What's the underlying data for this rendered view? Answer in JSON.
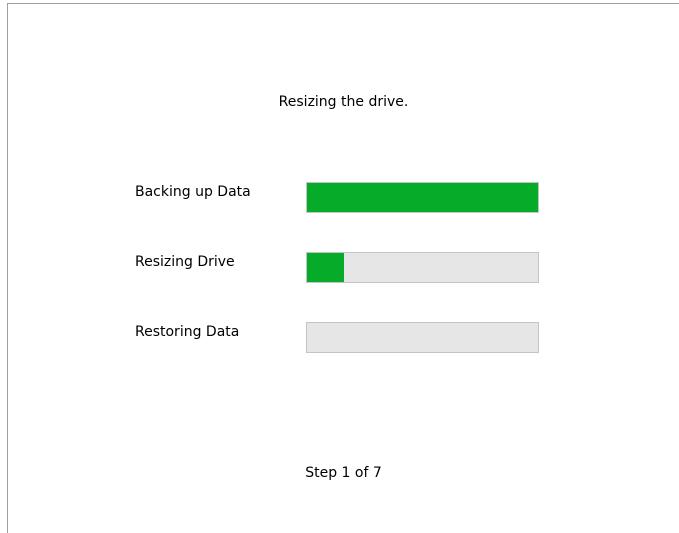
{
  "heading": "Resizing the drive.",
  "tasks": [
    {
      "label": "Backing up Data",
      "progress": 1.0
    },
    {
      "label": "Resizing Drive",
      "progress": 0.16
    },
    {
      "label": "Restoring Data",
      "progress": 0.0
    }
  ],
  "footer": "Step 1 of 7",
  "colors": {
    "progress_fill": "#06ab29",
    "progress_track": "#e6e6e6",
    "progress_border": "#c4c4c4"
  }
}
